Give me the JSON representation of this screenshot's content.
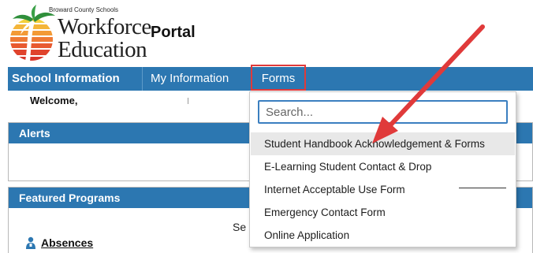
{
  "logo": {
    "org_text": "Broward County Schools",
    "line1": "Workforce",
    "line2": "Education"
  },
  "header": {
    "portal_title": "Portal"
  },
  "nav": {
    "items": [
      {
        "label": "School Information"
      },
      {
        "label": "My Information"
      },
      {
        "label": "Forms"
      }
    ]
  },
  "welcome": {
    "text": "Welcome,"
  },
  "panels": {
    "alerts": {
      "title": "Alerts"
    },
    "featured": {
      "title": "Featured Programs"
    }
  },
  "content": {
    "partial_text": "Se",
    "absences_label": "Absences"
  },
  "forms_menu": {
    "search_placeholder": "Search...",
    "items": [
      {
        "label": "Student Handbook Acknowledgement & Forms"
      },
      {
        "label": "E-Learning Student Contact & Drop"
      },
      {
        "label": "Internet Acceptable Use Form"
      },
      {
        "label": "Emergency Contact Form"
      },
      {
        "label": "Online Application"
      }
    ]
  },
  "colors": {
    "nav_blue": "#2c77b1",
    "annotation_red": "#e03a3a"
  },
  "icons": [
    "logo-palm-sun-icon",
    "person-icon",
    "annotation-arrow-icon"
  ]
}
